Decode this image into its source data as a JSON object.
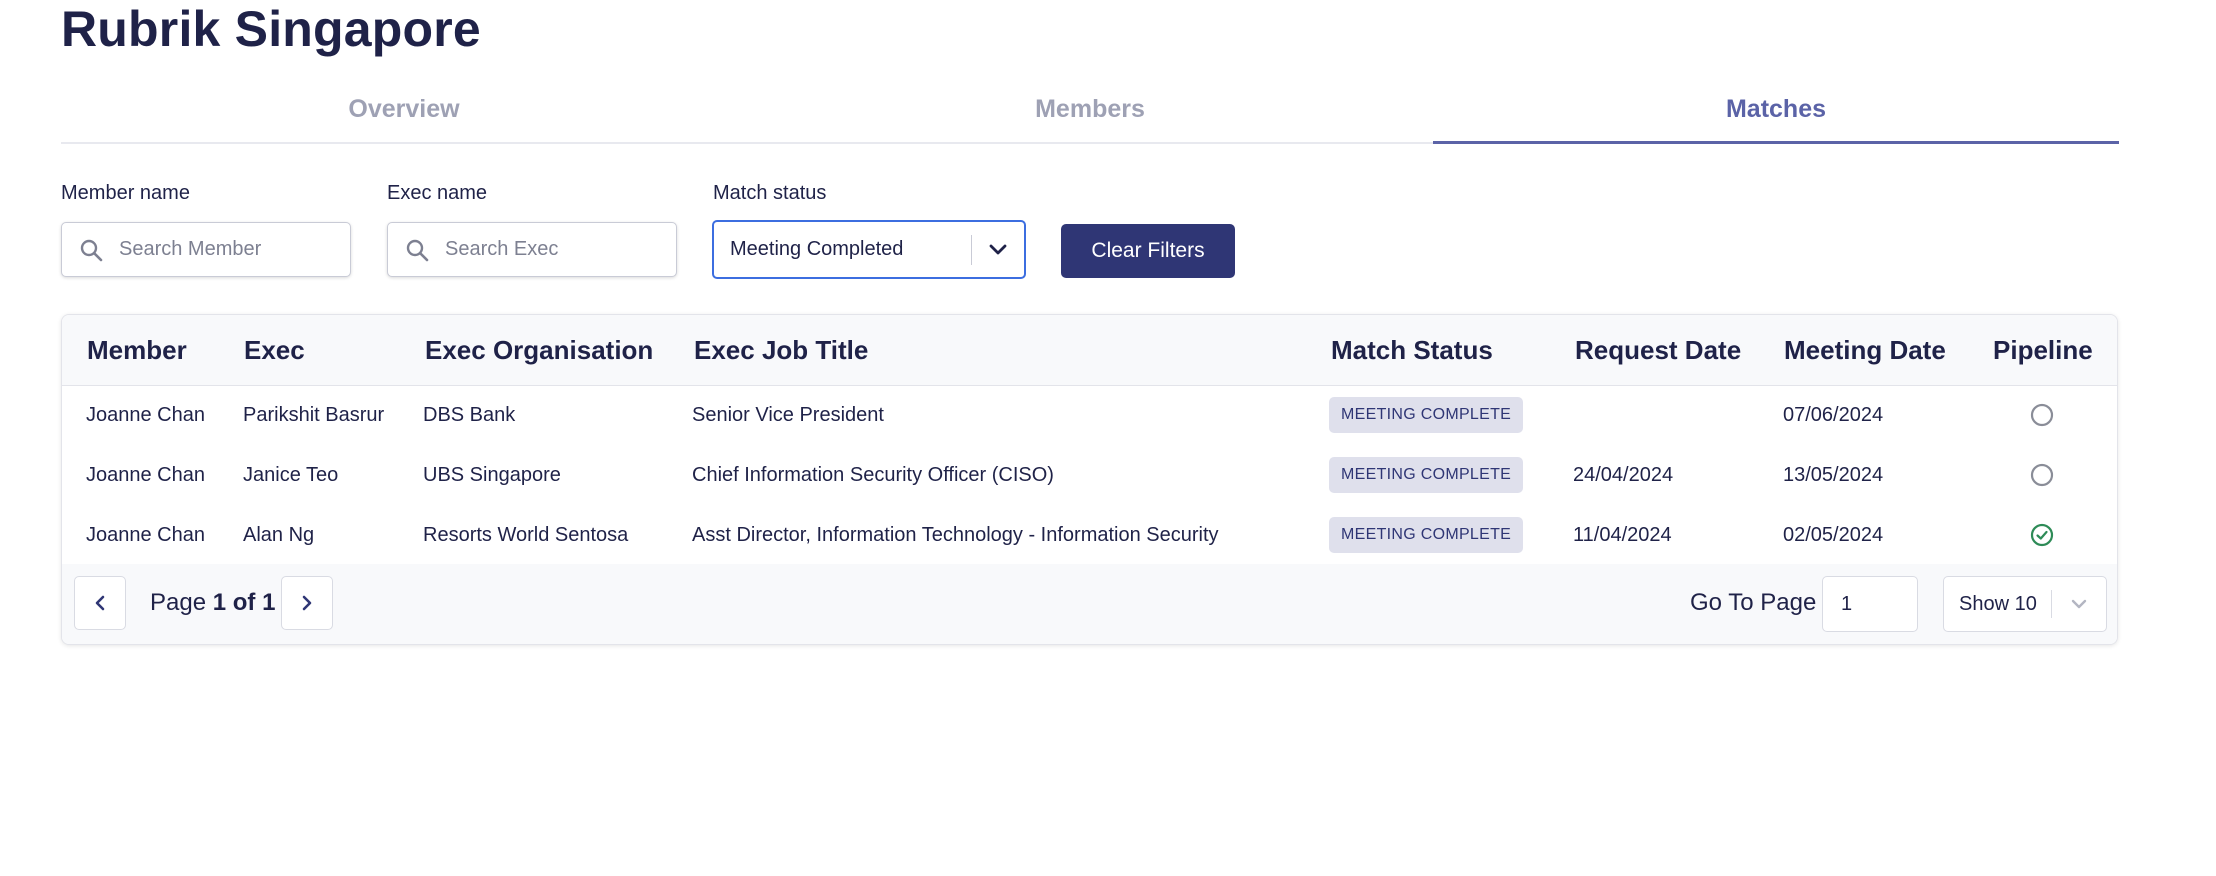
{
  "page": {
    "title": "Rubrik Singapore"
  },
  "tabs": [
    {
      "label": "Overview",
      "active": false
    },
    {
      "label": "Members",
      "active": false
    },
    {
      "label": "Matches",
      "active": true
    }
  ],
  "filters": {
    "member": {
      "label": "Member name",
      "placeholder": "Search Member",
      "value": ""
    },
    "exec": {
      "label": "Exec name",
      "placeholder": "Search Exec",
      "value": ""
    },
    "status": {
      "label": "Match status",
      "value": "Meeting Completed"
    },
    "clear_label": "Clear Filters"
  },
  "table": {
    "columns": [
      "Member",
      "Exec",
      "Exec Organisation",
      "Exec Job Title",
      "Match Status",
      "Request Date",
      "Meeting Date",
      "Pipeline"
    ],
    "rows": [
      {
        "member": "Joanne Chan",
        "exec": "Parikshit Basrur",
        "org": "DBS Bank",
        "title": "Senior Vice President",
        "status": "MEETING COMPLETE",
        "request_date": "",
        "meeting_date": "07/06/2024",
        "pipeline": false
      },
      {
        "member": "Joanne Chan",
        "exec": "Janice Teo",
        "org": "UBS Singapore",
        "title": "Chief Information Security Officer (CISO)",
        "status": "MEETING COMPLETE",
        "request_date": "24/04/2024",
        "meeting_date": "13/05/2024",
        "pipeline": false
      },
      {
        "member": "Joanne Chan",
        "exec": "Alan Ng",
        "org": "Resorts World Sentosa",
        "title": "Asst Director, Information Technology - Information Security",
        "status": "MEETING COMPLETE",
        "request_date": "11/04/2024",
        "meeting_date": "02/05/2024",
        "pipeline": true
      }
    ]
  },
  "pagination": {
    "page_prefix": "Page",
    "current_of_total": "1 of 1",
    "go_to_label": "Go To Page",
    "go_to_value": "1",
    "page_size": "Show 10"
  },
  "colors": {
    "brand": "#2f3675",
    "tab_active": "#5b63a7",
    "badge_bg": "#dfe0ec",
    "pipeline_yes": "#2e8b57",
    "pipeline_no": "#8a8d98"
  },
  "icons": {
    "search": "search-icon",
    "dropdown": "chevron-down-icon",
    "prev": "chevron-left-icon",
    "next": "chevron-right-icon",
    "pipeline_empty": "circle-outline-icon",
    "pipeline_checked": "check-circle-icon"
  }
}
